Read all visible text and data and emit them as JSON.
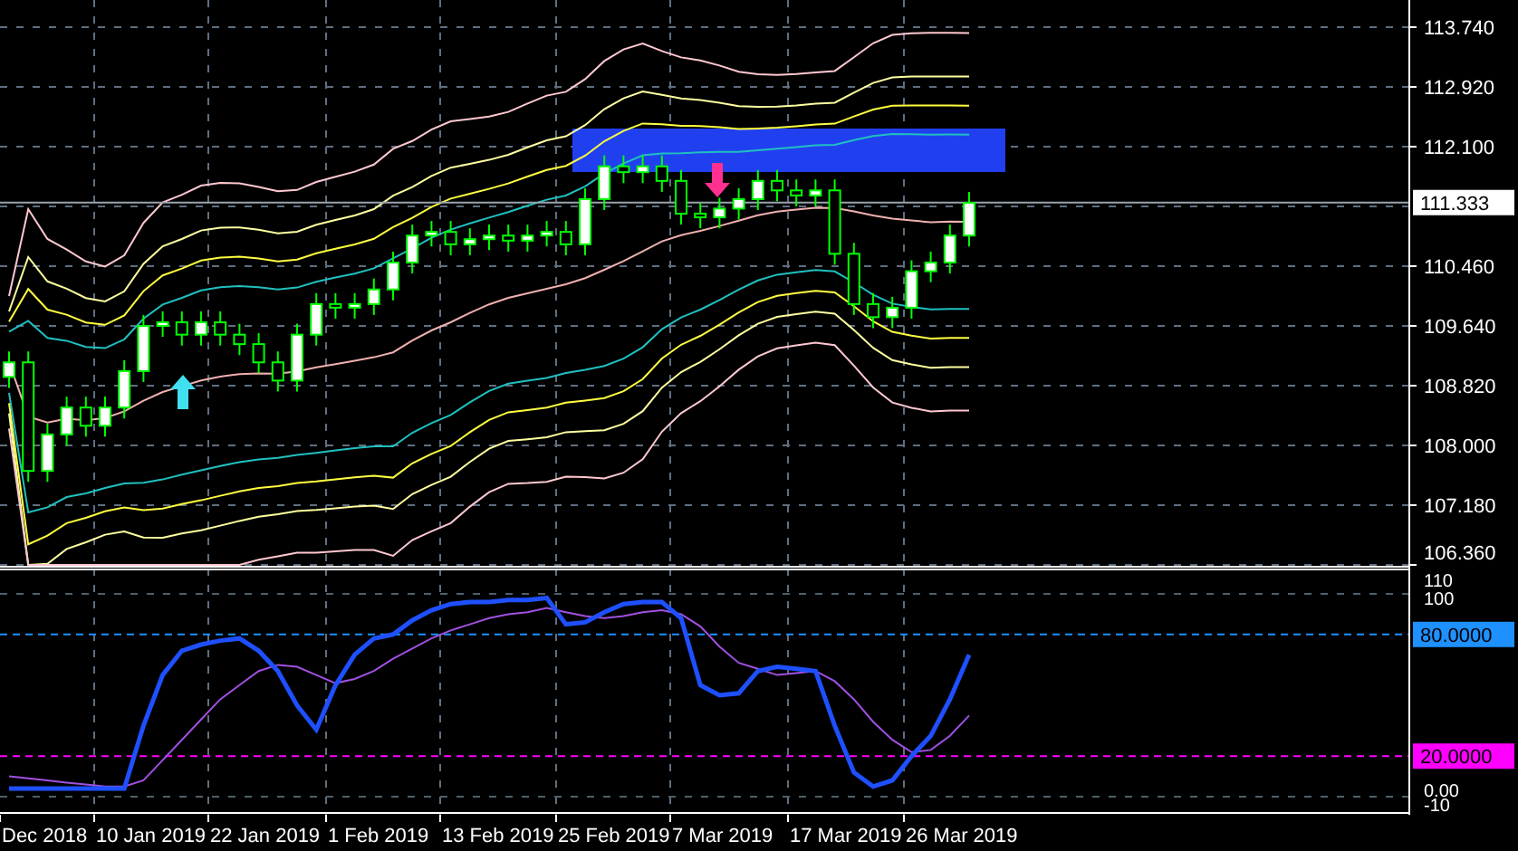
{
  "price_axis": {
    "labels": [
      "113.740",
      "112.920",
      "112.100",
      "110.460",
      "109.640",
      "108.820",
      "108.000",
      "107.180",
      "106.360"
    ],
    "current_price": "111.333"
  },
  "oscillator_axis": {
    "labels": [
      "110",
      "100",
      "0.00",
      "-10"
    ],
    "levels": [
      {
        "label": "80.0000",
        "color": "#1e90ff"
      },
      {
        "label": "20.0000",
        "color": "#ff00ff"
      }
    ]
  },
  "time_axis": {
    "labels": [
      "Dec 2018",
      "10 Jan 2019",
      "22 Jan 2019",
      "1 Feb 2019",
      "13 Feb 2019",
      "25 Feb 2019",
      "7 Mar 2019",
      "17 Mar 2019",
      "26 Mar 2019"
    ]
  }
}
